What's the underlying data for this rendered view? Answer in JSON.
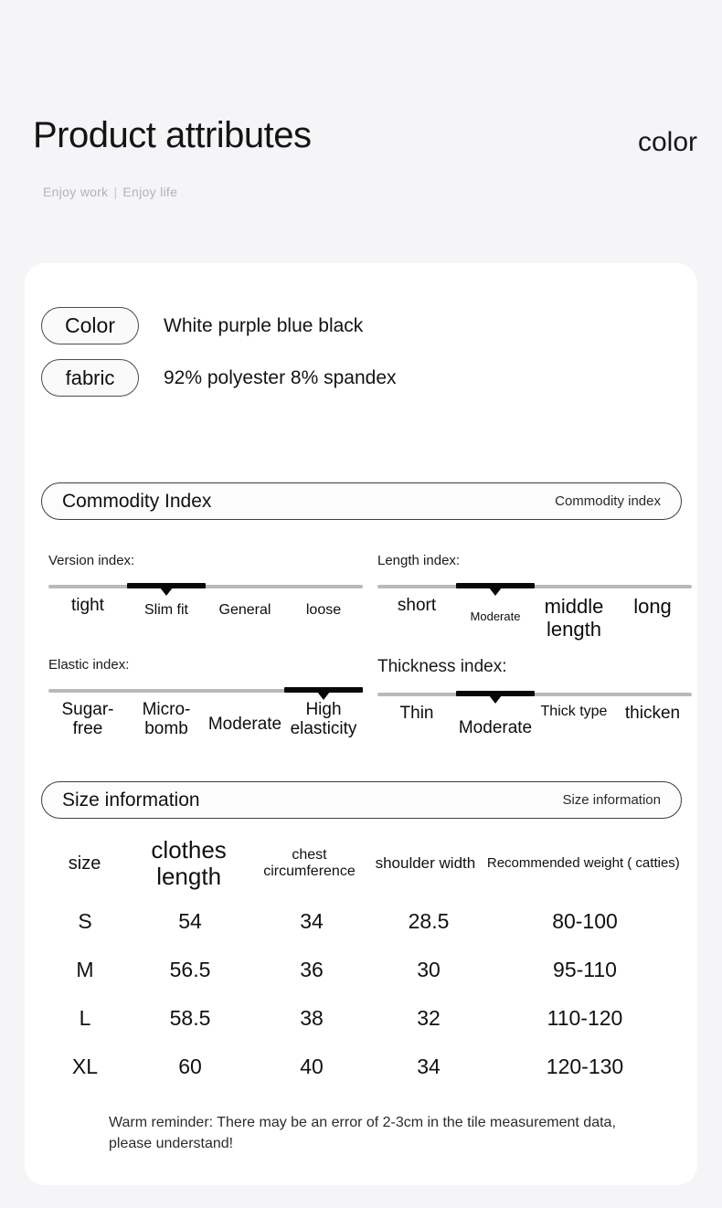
{
  "header": {
    "title": "Product attributes",
    "title_right": "color",
    "subtitle_left": "Enjoy work",
    "subtitle_sep": "|",
    "subtitle_right": "Enjoy life"
  },
  "attributes": [
    {
      "pill": "Color",
      "value": "White purple blue black"
    },
    {
      "pill": "fabric",
      "value": "92% polyester 8% spandex"
    }
  ],
  "commodity_section": {
    "title": "Commodity Index",
    "subtitle": "Commodity index"
  },
  "indexes": [
    {
      "label": "Version index:",
      "selected": 1,
      "ticks": [
        {
          "text": "tight",
          "size": "m",
          "offset": 0
        },
        {
          "text": "Slim fit",
          "size": "s",
          "offset": 1
        },
        {
          "text": "General",
          "size": "s",
          "offset": 1
        },
        {
          "text": "loose",
          "size": "s",
          "offset": 1
        }
      ]
    },
    {
      "label": "Length index:",
      "selected": 1,
      "ticks": [
        {
          "text": "short",
          "size": "m",
          "offset": 0
        },
        {
          "text": "Moderate",
          "size": "xs",
          "offset": 2
        },
        {
          "text": "middle length",
          "size": "l",
          "offset": 0
        },
        {
          "text": "long",
          "size": "l",
          "offset": 0
        }
      ]
    },
    {
      "label": "Elastic index:",
      "selected": 3,
      "ticks": [
        {
          "text": "Sugar-free",
          "size": "m",
          "offset": 0
        },
        {
          "text": "Micro-bomb",
          "size": "m",
          "offset": 0
        },
        {
          "text": "Moderate",
          "size": "m",
          "offset": 2
        },
        {
          "text": "High elasticity",
          "size": "m",
          "offset": 0
        }
      ]
    },
    {
      "label": "Thickness index:",
      "selected": 1,
      "ticks": [
        {
          "text": "Thin",
          "size": "m",
          "offset": 0
        },
        {
          "text": "Moderate",
          "size": "m",
          "offset": 2
        },
        {
          "text": "Thick type",
          "size": "s",
          "offset": 0
        },
        {
          "text": "thicken",
          "size": "m",
          "offset": 0
        }
      ]
    }
  ],
  "size_section": {
    "title": "Size information",
    "subtitle": "Size information"
  },
  "size_table": {
    "headers": [
      "size",
      "clothes length",
      "chest circumference",
      "shoulder width",
      "Recommended weight ( catties)"
    ],
    "rows": [
      [
        "S",
        "54",
        "34",
        "28.5",
        "80-100"
      ],
      [
        "M",
        "56.5",
        "36",
        "30",
        "95-110"
      ],
      [
        "L",
        "58.5",
        "38",
        "32",
        "110-120"
      ],
      [
        "XL",
        "60",
        "40",
        "34",
        "120-130"
      ]
    ]
  },
  "reminder": "Warm reminder: There may be an error of 2-3cm in the tile measurement data, please understand!",
  "colors": {
    "page_background": "#f5f4f6",
    "card_background": "#ffffff",
    "slider_track": "#b9b9b9",
    "slider_active": "#080808",
    "subtitle_text": "#b4b2b6",
    "body_text": "#111111"
  }
}
